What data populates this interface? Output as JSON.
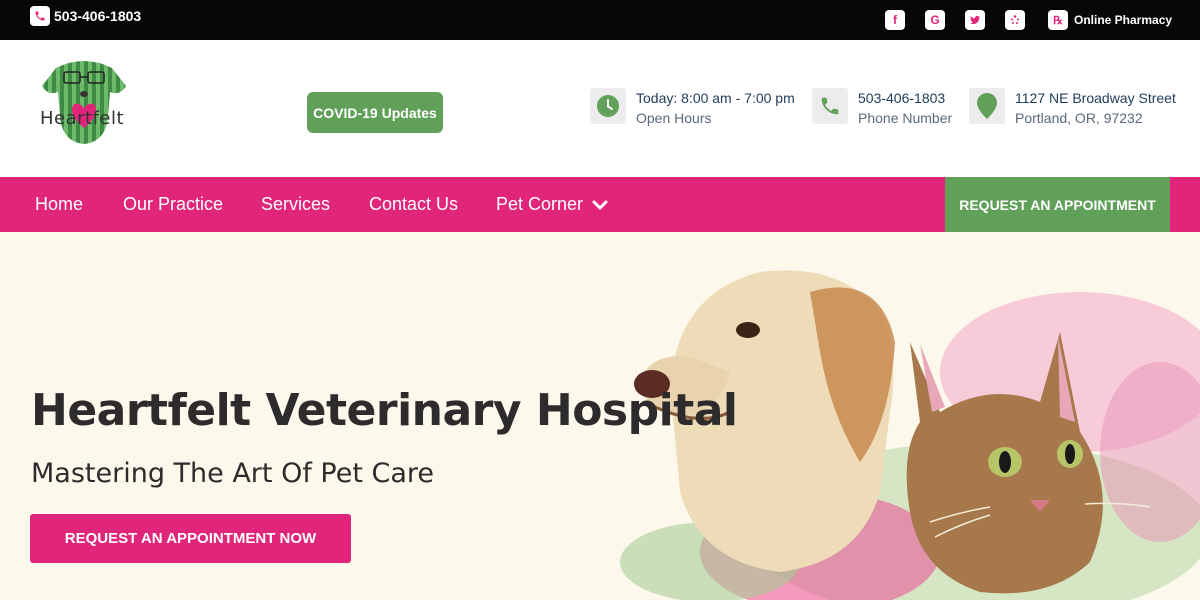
{
  "topbar": {
    "phone": "503-406-1803",
    "social_icons": [
      "facebook-icon",
      "google-icon",
      "twitter-icon",
      "yelp-icon"
    ],
    "pharmacy_label": "Online Pharmacy"
  },
  "header": {
    "logo_text": "Heartfelt",
    "covid_label": "COVID-19 Updates",
    "info": [
      {
        "icon": "clock-icon",
        "main": "Today: 8:00 am - 7:00 pm",
        "sub": "Open Hours"
      },
      {
        "icon": "phone-icon",
        "main": "503-406-1803",
        "sub": "Phone Number"
      },
      {
        "icon": "map-pin-icon",
        "main": "1127 NE Broadway Street",
        "sub": "Portland, OR, 97232"
      }
    ]
  },
  "nav": {
    "items": [
      "Home",
      "Our Practice",
      "Services",
      "Contact Us",
      "Pet Corner"
    ],
    "cta": "REQUEST AN APPOINTMENT"
  },
  "hero": {
    "title": "Heartfelt Veterinary Hospital",
    "subtitle": "Mastering The Art Of Pet Care",
    "button": "REQUEST AN APPOINTMENT NOW"
  },
  "colors": {
    "brand_pink": "#e1257a",
    "brand_green": "#61a059",
    "topbar_bg": "#070707",
    "hero_bg": "#fcf9ec"
  }
}
